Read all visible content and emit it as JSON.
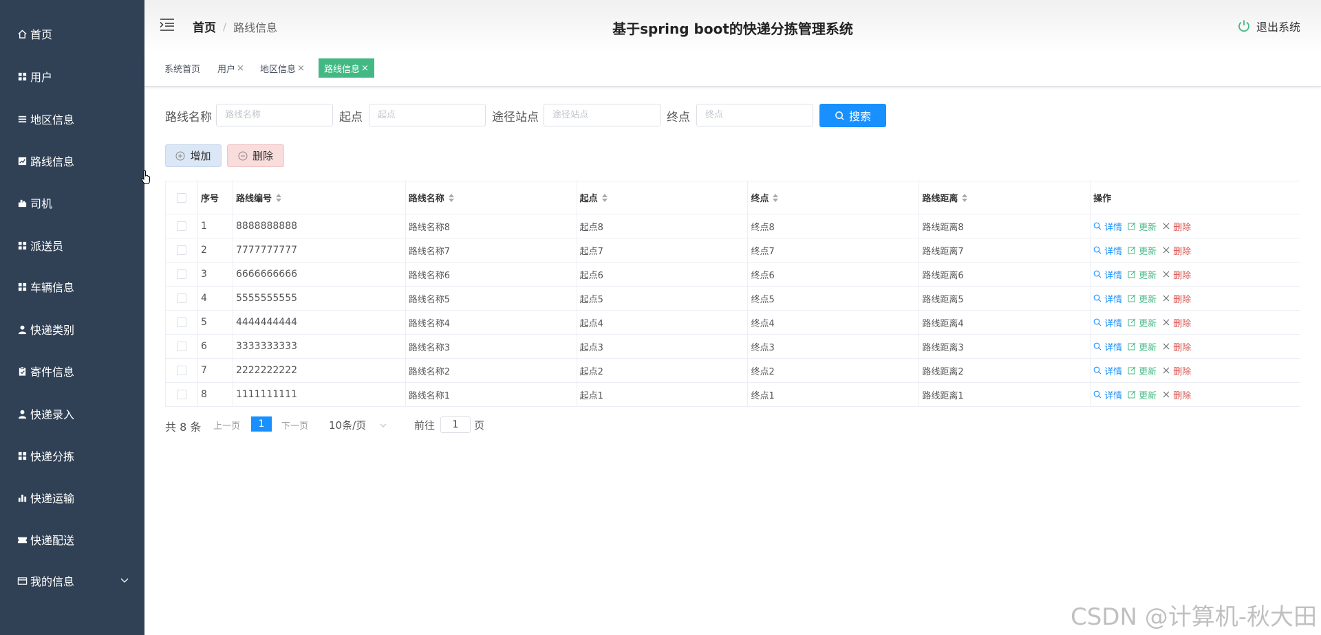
{
  "sidebar": {
    "items": [
      {
        "label": "首页",
        "icon": "home-icon"
      },
      {
        "label": "用户",
        "icon": "grid-icon"
      },
      {
        "label": "地区信息",
        "icon": "list-icon"
      },
      {
        "label": "路线信息",
        "icon": "chart-icon"
      },
      {
        "label": "司机",
        "icon": "driver-icon"
      },
      {
        "label": "派送员",
        "icon": "grid-icon"
      },
      {
        "label": "车辆信息",
        "icon": "grid-icon"
      },
      {
        "label": "快递类别",
        "icon": "user-icon"
      },
      {
        "label": "寄件信息",
        "icon": "clipboard-icon"
      },
      {
        "label": "快递录入",
        "icon": "user-icon"
      },
      {
        "label": "快递分拣",
        "icon": "grid-icon"
      },
      {
        "label": "快递运输",
        "icon": "bar-chart-icon"
      },
      {
        "label": "快递配送",
        "icon": "ticket-icon"
      },
      {
        "label": "我的信息",
        "icon": "card-icon"
      }
    ]
  },
  "header": {
    "breadcrumb_home": "首页",
    "breadcrumb_sep": "/",
    "breadcrumb_current": "路线信息",
    "title": "基于spring boot的快递分拣管理系统",
    "logout_label": "退出系统"
  },
  "tags": [
    {
      "label": "系统首页",
      "closable": false,
      "active": false
    },
    {
      "label": "用户",
      "closable": true,
      "active": false
    },
    {
      "label": "地区信息",
      "closable": true,
      "active": false
    },
    {
      "label": "路线信息",
      "closable": true,
      "active": true
    }
  ],
  "tag_close": "×",
  "search": {
    "route_name_label": "路线名称",
    "route_name_placeholder": "路线名称",
    "start_label": "起点",
    "start_placeholder": "起点",
    "via_label": "途径站点",
    "via_placeholder": "途径站点",
    "end_label": "终点",
    "end_placeholder": "终点",
    "button_label": "搜索"
  },
  "actions": {
    "add_label": "增加",
    "delete_label": "删除"
  },
  "table": {
    "headers": [
      "序号",
      "路线编号",
      "路线名称",
      "起点",
      "终点",
      "路线距离",
      "操作"
    ],
    "op_detail": "详情",
    "op_update": "更新",
    "op_delete": "删除",
    "rows": [
      {
        "index": "1",
        "code": "8888888888",
        "name": "路线名称8",
        "start": "起点8",
        "end": "终点8",
        "distance": "路线距离8"
      },
      {
        "index": "2",
        "code": "7777777777",
        "name": "路线名称7",
        "start": "起点7",
        "end": "终点7",
        "distance": "路线距离7"
      },
      {
        "index": "3",
        "code": "6666666666",
        "name": "路线名称6",
        "start": "起点6",
        "end": "终点6",
        "distance": "路线距离6"
      },
      {
        "index": "4",
        "code": "5555555555",
        "name": "路线名称5",
        "start": "起点5",
        "end": "终点5",
        "distance": "路线距离5"
      },
      {
        "index": "5",
        "code": "4444444444",
        "name": "路线名称4",
        "start": "起点4",
        "end": "终点4",
        "distance": "路线距离4"
      },
      {
        "index": "6",
        "code": "3333333333",
        "name": "路线名称3",
        "start": "起点3",
        "end": "终点3",
        "distance": "路线距离3"
      },
      {
        "index": "7",
        "code": "2222222222",
        "name": "路线名称2",
        "start": "起点2",
        "end": "终点2",
        "distance": "路线距离2"
      },
      {
        "index": "8",
        "code": "1111111111",
        "name": "路线名称1",
        "start": "起点1",
        "end": "终点1",
        "distance": "路线距离1"
      }
    ]
  },
  "pagination": {
    "total": "共 8 条",
    "prev": "上一页",
    "current": "1",
    "next": "下一页",
    "page_size": "10条/页",
    "goto_label": "前往",
    "goto_value": "1",
    "goto_unit": "页"
  },
  "watermark": "CSDN @计算机-秋大田",
  "colors": {
    "sidebar_bg": "#304156",
    "primary": "#1890ff",
    "tag_active": "#42b983",
    "danger": "#d9534f"
  }
}
